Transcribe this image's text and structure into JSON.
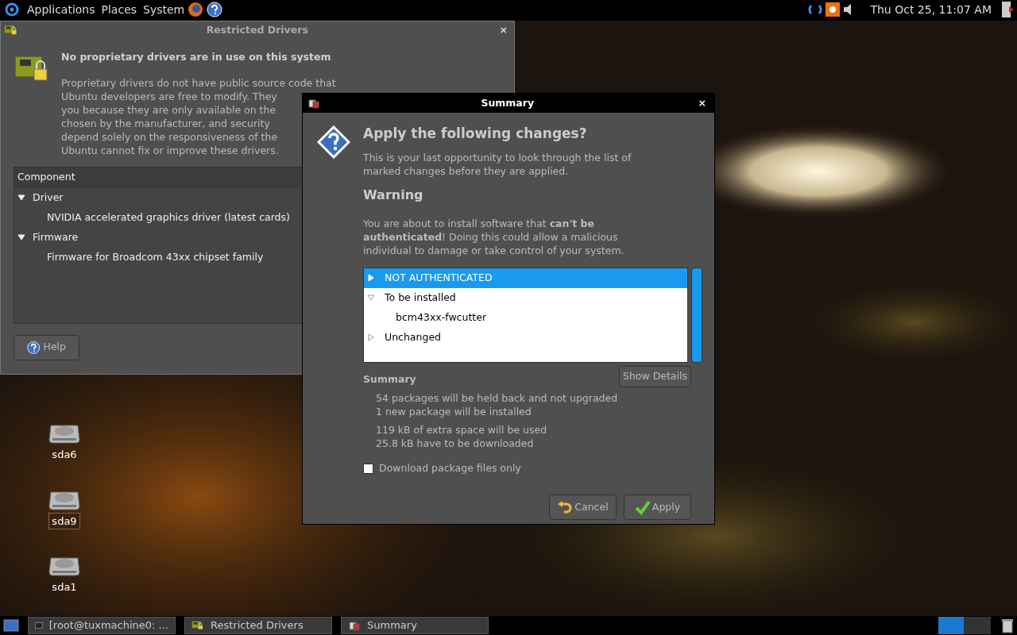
{
  "top_panel": {
    "menus": [
      "Applications",
      "Places",
      "System"
    ],
    "clock": "Thu Oct 25, 11:07 AM"
  },
  "desktop_icons": [
    {
      "label": "sda6",
      "selected": false
    },
    {
      "label": "sda9",
      "selected": true
    },
    {
      "label": "sda1",
      "selected": false
    }
  ],
  "restricted_drivers": {
    "title": "Restricted Drivers",
    "heading": "No proprietary drivers are in use on this system",
    "close_button": "×",
    "description_lines": [
      "Proprietary drivers do not have public source code that",
      "Ubuntu developers are free to modify. They",
      "you because they are only available on the",
      "chosen by the manufacturer, and security",
      "depend solely on the responsiveness of the",
      "Ubuntu cannot fix or improve these drivers."
    ],
    "table": {
      "column": "Component",
      "rows": [
        {
          "label": "Driver",
          "expanded": true,
          "children": [
            {
              "label": "NVIDIA accelerated graphics driver (latest cards)"
            }
          ]
        },
        {
          "label": "Firmware",
          "expanded": true,
          "children": [
            {
              "label": "Firmware for Broadcom 43xx chipset family"
            }
          ]
        }
      ]
    },
    "help_button": "Help"
  },
  "summary_dialog": {
    "title": "Summary",
    "close_button": "×",
    "heading": "Apply the following changes?",
    "intro": "This is your last opportunity to look through the list of marked changes before they are applied.",
    "warning_heading": "Warning",
    "warning": "You are about to install software that **can't be authenticated**! Doing this could allow a malicious individual to damage or take control of your system.",
    "changes": [
      {
        "label": "NOT AUTHENTICATED",
        "expanded": false,
        "selected": true
      },
      {
        "label": "To be installed",
        "expanded": true,
        "selected": false,
        "children": [
          {
            "label": "bcm43xx-fwcutter"
          }
        ]
      },
      {
        "label": "Unchanged",
        "expanded": false,
        "selected": false
      }
    ],
    "summary_heading": "Summary",
    "show_details": "Show Details",
    "summary_groups": [
      [
        "54 packages will be held back and not upgraded",
        "1 new package will be installed"
      ],
      [
        "119 kB of extra space will be used",
        "25.8 kB have to be downloaded"
      ]
    ],
    "checkbox": {
      "label": "Download package files only",
      "checked": false
    },
    "buttons": [
      {
        "kind": "cancel",
        "label": "Cancel"
      },
      {
        "kind": "apply",
        "label": "Apply"
      }
    ]
  },
  "taskbar": {
    "tasks": [
      {
        "kind": "terminal",
        "label": "[root@tuxmachine0: ..."
      },
      {
        "kind": "drivers",
        "label": "Restricted Drivers"
      },
      {
        "kind": "package",
        "label": "Summary"
      }
    ]
  }
}
